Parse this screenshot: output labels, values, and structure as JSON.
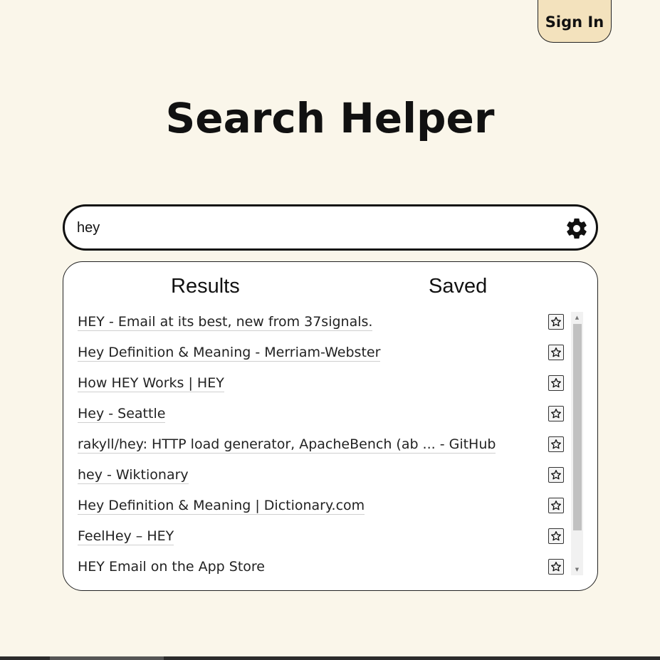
{
  "header": {
    "sign_in_label": "Sign In",
    "title": "Search Helper"
  },
  "search": {
    "value": "hey",
    "settings_icon": "gear-icon"
  },
  "panel": {
    "tabs": [
      {
        "label": "Results"
      },
      {
        "label": "Saved"
      }
    ],
    "results": [
      {
        "title": "HEY - Email at its best, new from 37signals."
      },
      {
        "title": "Hey Definition & Meaning - Merriam-Webster"
      },
      {
        "title": "How HEY Works | HEY"
      },
      {
        "title": "Hey - Seattle"
      },
      {
        "title": "rakyll/hey: HTTP load generator, ApacheBench (ab ... - GitHub"
      },
      {
        "title": "hey - Wiktionary"
      },
      {
        "title": "Hey Definition & Meaning | Dictionary.com"
      },
      {
        "title": "FeelHey – HEY"
      },
      {
        "title": "HEY Email on the App Store"
      }
    ],
    "save_icon": "star-icon"
  }
}
